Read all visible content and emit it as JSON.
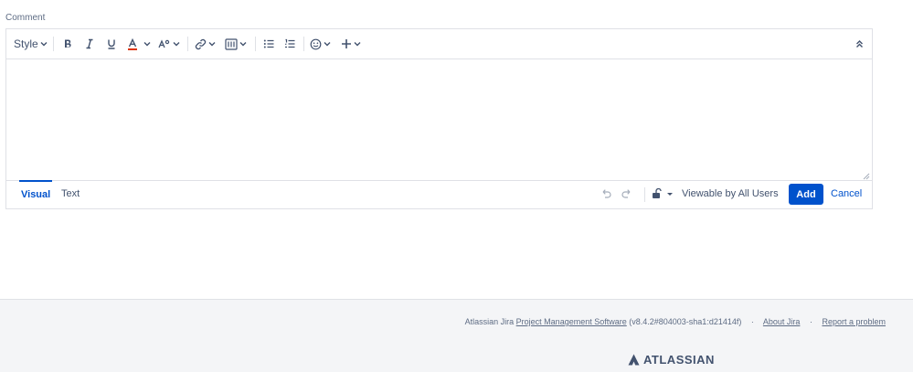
{
  "comment": {
    "label": "Comment"
  },
  "toolbar": {
    "style_label": "Style",
    "bold_icon": "bold-icon",
    "italic_icon": "italic-icon",
    "underline_icon": "underline-icon",
    "text_color_icon": "text-color-icon",
    "text_color_accent": "#de350b"
  },
  "editor_footer": {
    "tabs": [
      {
        "label": "Visual",
        "active": true
      },
      {
        "label": "Text",
        "active": false
      }
    ],
    "viewable_label": "Viewable by All Users",
    "add_label": "Add",
    "cancel_label": "Cancel"
  },
  "footer": {
    "product_prefix": "Atlassian Jira",
    "product_link": "Project Management Software",
    "version": "(v8.4.2#804003-sha1:d21414f)",
    "separator": "·",
    "about_link": "About Jira",
    "report_link": "Report a problem",
    "logo_text": "ATLASSIAN"
  },
  "colors": {
    "primary": "#0052cc",
    "text": "#42526e",
    "border": "#dfe1e6",
    "footer_bg": "#f4f5f7"
  }
}
